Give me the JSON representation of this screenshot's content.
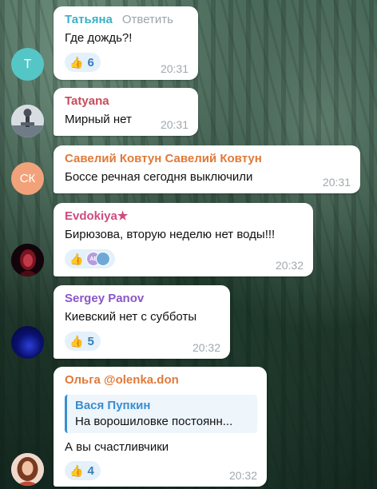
{
  "messages": [
    {
      "sender": "Татьяна",
      "reply_label": "Ответить",
      "text": "Где дождь?!",
      "reaction_count": "6",
      "time": "20:31",
      "avatar_letter": "Т"
    },
    {
      "sender": "Tatyana",
      "text": "Мирный нет",
      "time": "20:31"
    },
    {
      "sender": "Савелий Ковтун Савелий Ковтун",
      "text": "Боссе речная сегодня выключили",
      "time": "20:31",
      "avatar_letters": "СК"
    },
    {
      "sender": "Evdokiya★",
      "text": "Бирюзова, вторую неделю нет воды!!!",
      "time": "20:32",
      "reactor_initials": "AB"
    },
    {
      "sender": "Sergey Panov",
      "text": "Киевский нет с субботы",
      "reaction_count": "5",
      "time": "20:32"
    },
    {
      "sender": "Ольга @olenka.don",
      "quote_author": "Вася Пупкин",
      "quote_text": "На ворошиловке постоянн...",
      "text": "А вы счастливчики",
      "reaction_count": "4",
      "time": "20:32"
    }
  ],
  "colors": {
    "tatiana": "#3bb0c6",
    "tatyana": "#c84a5a",
    "saveliy": "#e07a3a",
    "evdokiya": "#d04b7e",
    "sergey": "#8a56c9",
    "olga": "#e07a3a",
    "avatar_teal": "#55c6c6",
    "avatar_orange": "#f2a27a"
  },
  "icons": {
    "reaction": "thumbs-up-icon"
  }
}
